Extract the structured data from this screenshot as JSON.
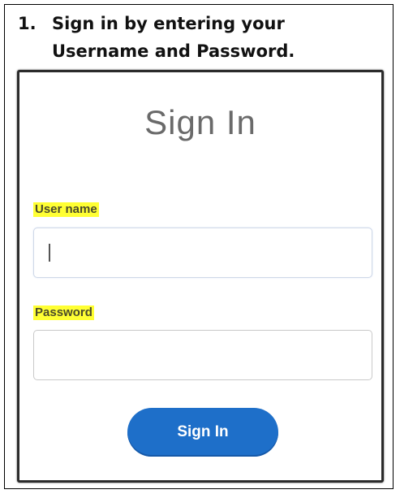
{
  "instruction": {
    "number": "1.",
    "line1": "Sign in by entering your",
    "line2": "Username and Password."
  },
  "form": {
    "title": "Sign In",
    "username_label": "User name",
    "username_value": "",
    "password_label": "Password",
    "password_value": "",
    "submit_label": "Sign In"
  },
  "colors": {
    "accent": "#1e6fc9",
    "highlight": "#ffff33",
    "title_text": "#6a6a6a"
  }
}
